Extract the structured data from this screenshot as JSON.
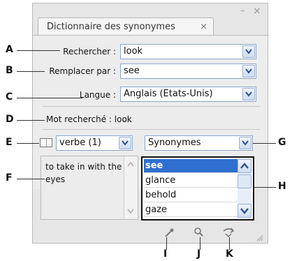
{
  "window": {
    "minimize_glyph": "–",
    "close_glyph": "×"
  },
  "tab": {
    "title": "Dictionnaire des synonymes",
    "close_glyph": "×"
  },
  "fields": {
    "search_label": "Rechercher :",
    "search_value": "look",
    "replace_label": "Remplacer par :",
    "replace_value": "see",
    "language_label": "Langue :",
    "language_value": "Anglais (Etats-Unis)"
  },
  "looked_up": {
    "text": "Mot recherché : look"
  },
  "meanings": {
    "selected": "verbe (1)"
  },
  "list_type": {
    "selected": "Synonymes"
  },
  "definition": {
    "text": "to take in with the eyes"
  },
  "synonyms": [
    "see",
    "glance",
    "behold",
    "gaze"
  ],
  "callouts": {
    "a": "A",
    "b": "B",
    "c": "C",
    "d": "D",
    "e": "E",
    "f": "F",
    "g": "G",
    "h": "H",
    "i": "I",
    "j": "J",
    "k": "K"
  },
  "icons": {
    "insert": "eyedropper-icon",
    "lookup": "magnifier-icon",
    "back": "back-icon",
    "view": "book-icon"
  },
  "colors": {
    "selection": "#2f6fd0",
    "field_border": "#8aa6c8",
    "panel_bg": "#e6e6e6"
  }
}
